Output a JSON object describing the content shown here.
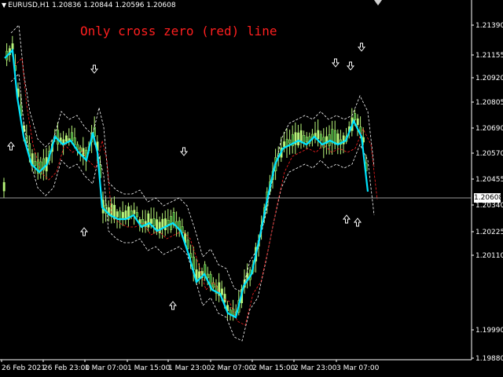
{
  "header": {
    "symbol_timeframe": "EURUSD,H1",
    "ohlc": "1.20836 1.20844 1.20596 1.20608",
    "menu_icon": "triangle-down-icon"
  },
  "annotation": "Only cross zero (red) line",
  "current_price": "1.20608",
  "price_axis": [
    "1.21390",
    "1.21155",
    "1.20920",
    "1.20805",
    "1.20690",
    "1.20570",
    "1.20455",
    "1.20340",
    "1.20225",
    "1.20110",
    "1.19990",
    "1.19880"
  ],
  "time_axis": [
    "26 Feb 2021",
    "26 Feb 23:00",
    "1 Mar 07:00",
    "1 Mar 15:00",
    "1 Mar 23:00",
    "2 Mar 07:00",
    "2 Mar 15:00",
    "2 Mar 23:00",
    "3 Mar 07:00"
  ],
  "colors": {
    "background": "#000000",
    "bull_candle": "#b8f57a",
    "bear_candle": "#2e8b2e",
    "main_line": "#00e5ff",
    "zero_line": "#ff2020",
    "band": "#ffffff",
    "annotation": "#ff1f1f"
  },
  "chart_data": {
    "type": "line",
    "symbol": "EURUSD",
    "timeframe": "H1",
    "ylim": [
      1.1988,
      1.2145
    ],
    "x": [
      "26 Feb 2021",
      "26 Feb 23:00",
      "1 Mar 07:00",
      "1 Mar 15:00",
      "1 Mar 23:00",
      "2 Mar 07:00",
      "2 Mar 15:00",
      "2 Mar 23:00",
      "3 Mar 07:00"
    ],
    "series": [
      {
        "values": [
          1.2125,
          1.2095,
          1.2085,
          1.207,
          1.2055,
          1.2052,
          1.205,
          1.204,
          1.2018,
          1.2005,
          1.2038,
          1.2062,
          1.2085,
          1.2095,
          1.209,
          1.208,
          1.2098,
          1.21,
          1.209,
          1.2075,
          1.2065
        ]
      },
      {
        "values": [
          1.211,
          1.209,
          1.208,
          1.2068,
          1.206,
          1.2055,
          1.2048,
          1.2035,
          1.202,
          1.2018,
          1.203,
          1.2055,
          1.2075,
          1.2082,
          1.209,
          1.209,
          1.2092,
          1.209,
          1.2085,
          1.208,
          1.2078
        ]
      }
    ],
    "signals": {
      "up_arrows": 8,
      "down_arrows": 6
    }
  }
}
